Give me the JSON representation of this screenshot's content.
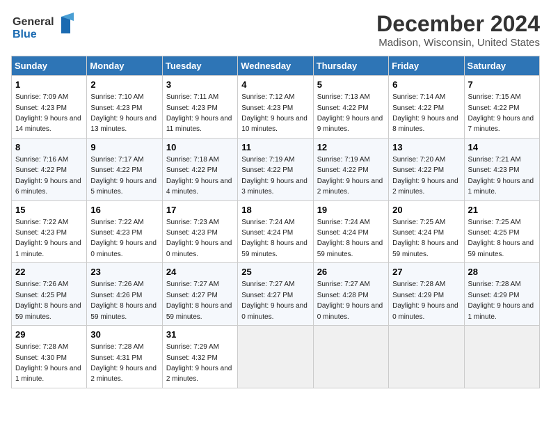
{
  "header": {
    "logo_line1": "General",
    "logo_line2": "Blue",
    "title": "December 2024",
    "subtitle": "Madison, Wisconsin, United States"
  },
  "calendar": {
    "days_of_week": [
      "Sunday",
      "Monday",
      "Tuesday",
      "Wednesday",
      "Thursday",
      "Friday",
      "Saturday"
    ],
    "weeks": [
      [
        {
          "day": 1,
          "sunrise": "7:09 AM",
          "sunset": "4:23 PM",
          "daylight": "9 hours and 14 minutes."
        },
        {
          "day": 2,
          "sunrise": "7:10 AM",
          "sunset": "4:23 PM",
          "daylight": "9 hours and 13 minutes."
        },
        {
          "day": 3,
          "sunrise": "7:11 AM",
          "sunset": "4:23 PM",
          "daylight": "9 hours and 11 minutes."
        },
        {
          "day": 4,
          "sunrise": "7:12 AM",
          "sunset": "4:23 PM",
          "daylight": "9 hours and 10 minutes."
        },
        {
          "day": 5,
          "sunrise": "7:13 AM",
          "sunset": "4:22 PM",
          "daylight": "9 hours and 9 minutes."
        },
        {
          "day": 6,
          "sunrise": "7:14 AM",
          "sunset": "4:22 PM",
          "daylight": "9 hours and 8 minutes."
        },
        {
          "day": 7,
          "sunrise": "7:15 AM",
          "sunset": "4:22 PM",
          "daylight": "9 hours and 7 minutes."
        }
      ],
      [
        {
          "day": 8,
          "sunrise": "7:16 AM",
          "sunset": "4:22 PM",
          "daylight": "9 hours and 6 minutes."
        },
        {
          "day": 9,
          "sunrise": "7:17 AM",
          "sunset": "4:22 PM",
          "daylight": "9 hours and 5 minutes."
        },
        {
          "day": 10,
          "sunrise": "7:18 AM",
          "sunset": "4:22 PM",
          "daylight": "9 hours and 4 minutes."
        },
        {
          "day": 11,
          "sunrise": "7:19 AM",
          "sunset": "4:22 PM",
          "daylight": "9 hours and 3 minutes."
        },
        {
          "day": 12,
          "sunrise": "7:19 AM",
          "sunset": "4:22 PM",
          "daylight": "9 hours and 2 minutes."
        },
        {
          "day": 13,
          "sunrise": "7:20 AM",
          "sunset": "4:22 PM",
          "daylight": "9 hours and 2 minutes."
        },
        {
          "day": 14,
          "sunrise": "7:21 AM",
          "sunset": "4:23 PM",
          "daylight": "9 hours and 1 minute."
        }
      ],
      [
        {
          "day": 15,
          "sunrise": "7:22 AM",
          "sunset": "4:23 PM",
          "daylight": "9 hours and 1 minute."
        },
        {
          "day": 16,
          "sunrise": "7:22 AM",
          "sunset": "4:23 PM",
          "daylight": "9 hours and 0 minutes."
        },
        {
          "day": 17,
          "sunrise": "7:23 AM",
          "sunset": "4:23 PM",
          "daylight": "9 hours and 0 minutes."
        },
        {
          "day": 18,
          "sunrise": "7:24 AM",
          "sunset": "4:24 PM",
          "daylight": "8 hours and 59 minutes."
        },
        {
          "day": 19,
          "sunrise": "7:24 AM",
          "sunset": "4:24 PM",
          "daylight": "8 hours and 59 minutes."
        },
        {
          "day": 20,
          "sunrise": "7:25 AM",
          "sunset": "4:24 PM",
          "daylight": "8 hours and 59 minutes."
        },
        {
          "day": 21,
          "sunrise": "7:25 AM",
          "sunset": "4:25 PM",
          "daylight": "8 hours and 59 minutes."
        }
      ],
      [
        {
          "day": 22,
          "sunrise": "7:26 AM",
          "sunset": "4:25 PM",
          "daylight": "8 hours and 59 minutes."
        },
        {
          "day": 23,
          "sunrise": "7:26 AM",
          "sunset": "4:26 PM",
          "daylight": "8 hours and 59 minutes."
        },
        {
          "day": 24,
          "sunrise": "7:27 AM",
          "sunset": "4:27 PM",
          "daylight": "8 hours and 59 minutes."
        },
        {
          "day": 25,
          "sunrise": "7:27 AM",
          "sunset": "4:27 PM",
          "daylight": "9 hours and 0 minutes."
        },
        {
          "day": 26,
          "sunrise": "7:27 AM",
          "sunset": "4:28 PM",
          "daylight": "9 hours and 0 minutes."
        },
        {
          "day": 27,
          "sunrise": "7:28 AM",
          "sunset": "4:29 PM",
          "daylight": "9 hours and 0 minutes."
        },
        {
          "day": 28,
          "sunrise": "7:28 AM",
          "sunset": "4:29 PM",
          "daylight": "9 hours and 1 minute."
        }
      ],
      [
        {
          "day": 29,
          "sunrise": "7:28 AM",
          "sunset": "4:30 PM",
          "daylight": "9 hours and 1 minute."
        },
        {
          "day": 30,
          "sunrise": "7:28 AM",
          "sunset": "4:31 PM",
          "daylight": "9 hours and 2 minutes."
        },
        {
          "day": 31,
          "sunrise": "7:29 AM",
          "sunset": "4:32 PM",
          "daylight": "9 hours and 2 minutes."
        },
        null,
        null,
        null,
        null
      ]
    ]
  }
}
